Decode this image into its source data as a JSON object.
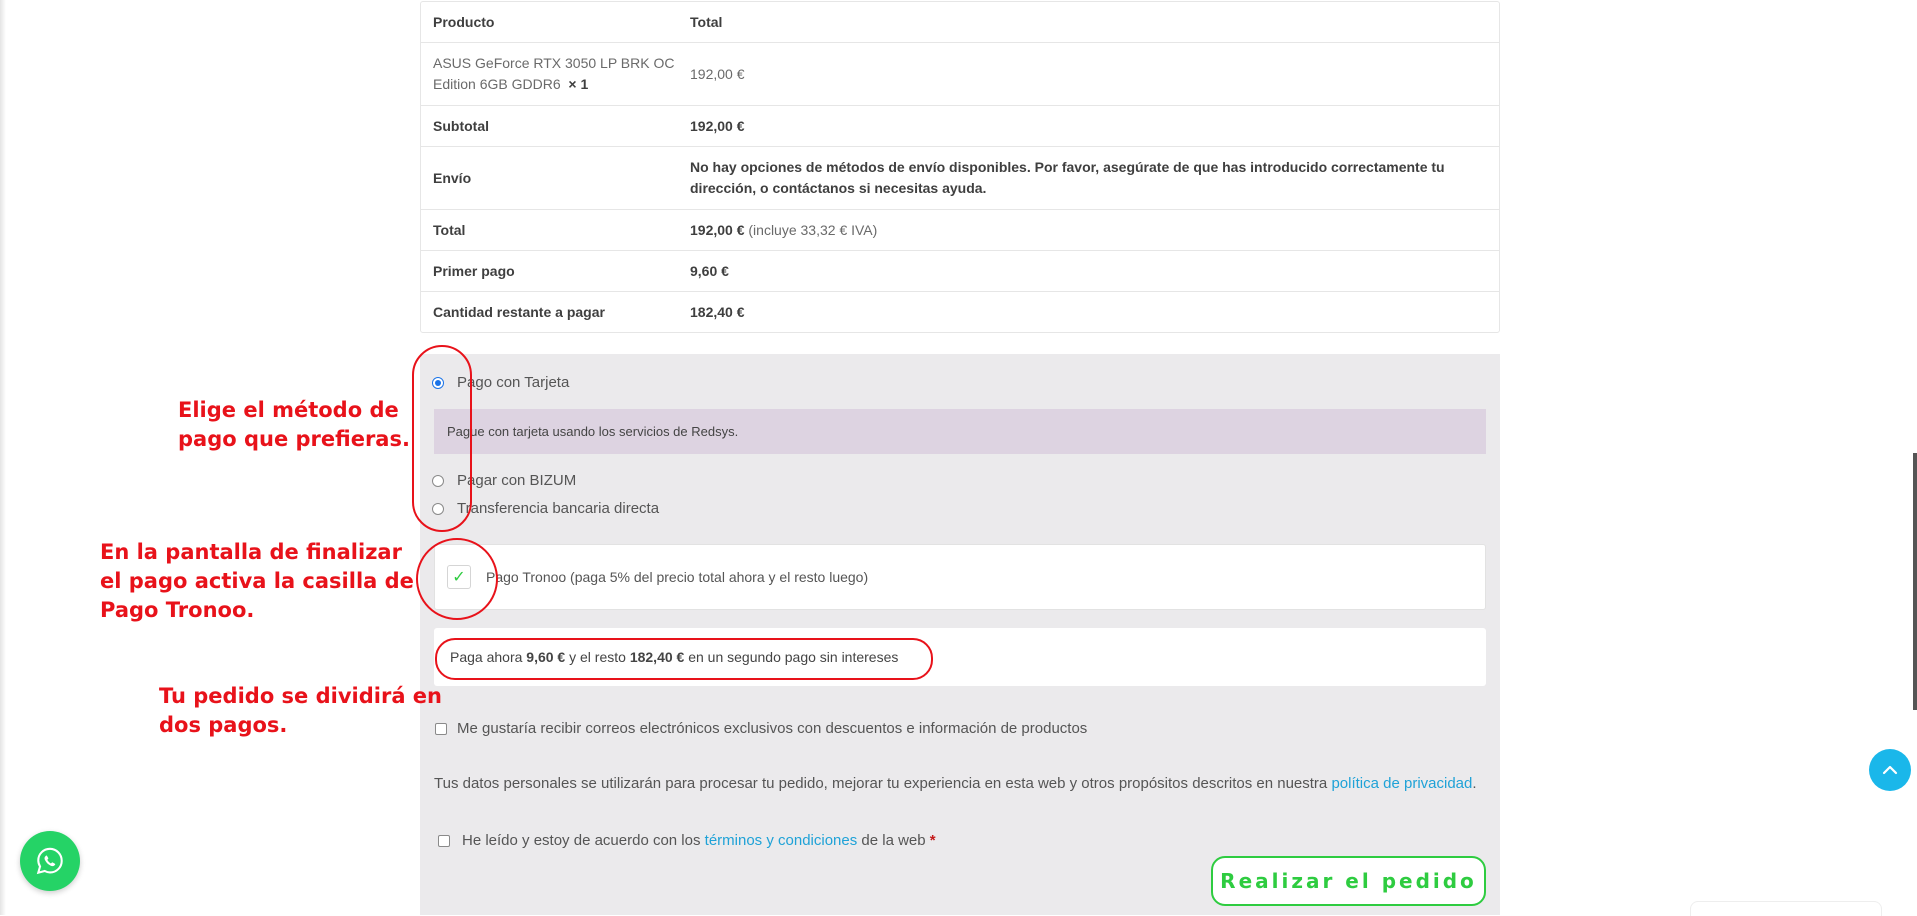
{
  "order_table": {
    "header": {
      "product": "Producto",
      "total": "Total"
    },
    "item": {
      "name": "ASUS GeForce RTX 3050 LP BRK OC Edition 6GB GDDR6",
      "qty": "× 1",
      "price": "192,00 €"
    },
    "subtotal": {
      "label": "Subtotal",
      "value": "192,00 €"
    },
    "shipping": {
      "label": "Envío",
      "value": "No hay opciones de métodos de envío disponibles. Por favor, asegúrate de que has introducido correctamente tu dirección, o contáctanos si necesitas ayuda."
    },
    "total": {
      "label": "Total",
      "value": "192,00 €",
      "tax_note": "(incluye 33,32 € IVA)"
    },
    "first_payment": {
      "label": "Primer pago",
      "value": "9,60 €"
    },
    "remaining": {
      "label": "Cantidad restante a pagar",
      "value": "182,40 €"
    }
  },
  "payment": {
    "methods": [
      {
        "label": "Pago con Tarjeta",
        "selected": true
      },
      {
        "label": "Pagar con BIZUM",
        "selected": false
      },
      {
        "label": "Transferencia bancaria directa",
        "selected": false
      }
    ],
    "card_description": "Pague con tarjeta usando los servicios de Redsys.",
    "tronoo": {
      "label": "Pago Tronoo (paga 5% del precio total ahora y el resto luego)",
      "checked": true,
      "check_glyph": "✓"
    },
    "split": {
      "prefix": "Paga ahora",
      "now": "9,60 €",
      "middle": "y el resto",
      "rest": "182,40 €",
      "suffix": "en un segundo pago sin intereses"
    },
    "newsletter_label": "Me gustaría recibir correos electrónicos exclusivos con descuentos e información de productos",
    "privacy": {
      "text": "Tus datos personales se utilizarán para procesar tu pedido, mejorar tu experiencia en esta web y otros propósitos descritos en nuestra",
      "link": "política de privacidad",
      "end": "."
    },
    "terms": {
      "prefix": "He leído y estoy de acuerdo con los",
      "link": "términos y condiciones",
      "suffix": "de la web",
      "required": "*"
    },
    "place_order": "Realizar el pedido"
  },
  "annotations": {
    "choose_method": "Elige el método de\npago que prefieras.",
    "activate_tronoo": "En la pantalla de finalizar\nel pago activa la casilla de\nPago Tronoo.",
    "split_order": "Tu pedido se dividirá en\ndos pagos."
  },
  "widgets": {
    "whatsapp_icon": "whatsapp-icon",
    "scroll_top_icon": "chevron-up-icon"
  },
  "colors": {
    "annotation_red": "#e8121a",
    "accent_green": "#2ecc40",
    "link_blue": "#1fa2d7",
    "whatsapp_green": "#25d366",
    "scroll_top_blue": "#1ab7ea",
    "panel_gray": "#ebeaec",
    "description_lilac": "#ddd3e1"
  }
}
